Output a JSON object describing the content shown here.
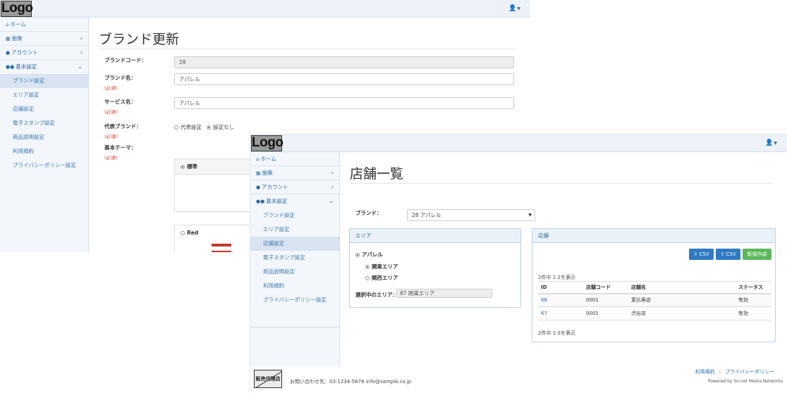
{
  "brand_update": {
    "logo": "Logo",
    "nav": {
      "home": "ホーム",
      "measures": "施策",
      "account": "アカウント",
      "basic_settings": "基本設定",
      "sub": [
        "ブランド設定",
        "エリア設定",
        "店舗設定",
        "電子スタンプ設定",
        "商品説明設定",
        "利用規約",
        "プライバシーポリシー設定"
      ]
    },
    "title": "ブランド更新",
    "fields": {
      "brand_code_label": "ブランドコード：",
      "brand_code_value": "28",
      "brand_name_label": "ブランド名：",
      "brand_name_value": "アパレル",
      "service_name_label": "サービス名：",
      "service_name_value": "アパレル",
      "rep_brand_label": "代表ブランド：",
      "rep_option_yes": "代表設定",
      "rep_option_no": "設定なし",
      "theme_label": "基本テーマ：",
      "required": "(必須)",
      "theme_standard": "標準",
      "theme_red": "Red"
    }
  },
  "store_list": {
    "logo": "Logo",
    "nav": {
      "home": "ホーム",
      "measures": "施策",
      "account": "アカウント",
      "basic_settings": "基本設定",
      "sub": [
        "ブランド設定",
        "エリア設定",
        "店舗設定",
        "電子スタンプ設定",
        "商品説明設定",
        "利用規約",
        "プライバシーポリシー設定"
      ]
    },
    "title": "店舗一覧",
    "brand_label": "ブランド：",
    "brand_selected": "28 アパレル",
    "area_panel": {
      "title": "エリア",
      "root": "アパレル",
      "children": [
        "関東エリア",
        "関西エリア"
      ],
      "selected_label": "選択中のエリア：",
      "selected_value": "87  関東エリア"
    },
    "store_panel": {
      "title": "店舗",
      "csv_download": "CSV",
      "csv_upload": "CSV",
      "new_button": "新規作成",
      "count_text": "2件中 1-2を表示",
      "columns": [
        "ID",
        "店舗コード",
        "店舗名",
        "ステータス"
      ],
      "rows": [
        {
          "id": "66",
          "code": "0001",
          "name": "恵比寿店",
          "status": "有効"
        },
        {
          "id": "67",
          "code": "0001",
          "name": "渋谷店",
          "status": "有効"
        }
      ]
    },
    "footer": {
      "agent_logo": "販売代理店",
      "contact": "お問い合わせ先：03-1234-5678 info@sample.co.jp",
      "terms": "利用規約",
      "privacy": "プライバシーポリシー",
      "powered": "Powered by So-net Media Networks"
    }
  },
  "colors": {
    "accent": "#2d6aa6",
    "required": "#d9342b",
    "csv_button": "#2f7ac2",
    "new_button": "#5cb85c"
  }
}
